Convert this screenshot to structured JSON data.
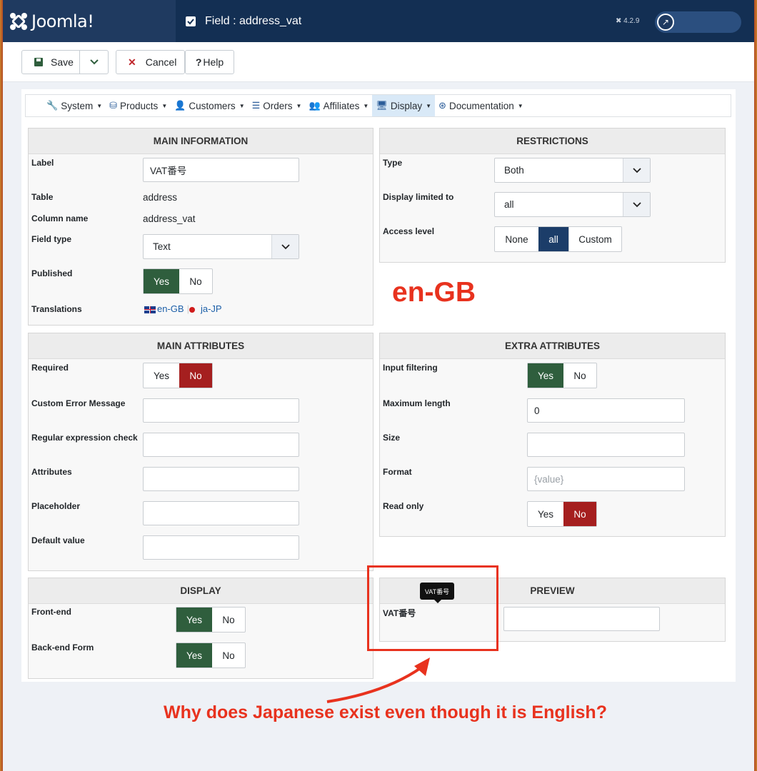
{
  "header": {
    "logo_text": "Joomla!",
    "page_title": "Field : address_vat",
    "version": "4.2.9"
  },
  "toolbar": {
    "save_label": "Save",
    "cancel_label": "Cancel",
    "help_label": "Help"
  },
  "menu": [
    {
      "label": "System",
      "icon": "wrench-icon"
    },
    {
      "label": "Products",
      "icon": "cubes-icon"
    },
    {
      "label": "Customers",
      "icon": "user-icon"
    },
    {
      "label": "Orders",
      "icon": "list-icon"
    },
    {
      "label": "Affiliates",
      "icon": "users-icon"
    },
    {
      "label": "Display",
      "icon": "monitor-icon",
      "active": true
    },
    {
      "label": "Documentation",
      "icon": "lifebuoy-icon"
    }
  ],
  "main_information": {
    "title": "MAIN INFORMATION",
    "label_label": "Label",
    "label_value": "VAT番号",
    "table_label": "Table",
    "table_value": "address",
    "column_label": "Column name",
    "column_value": "address_vat",
    "field_type_label": "Field type",
    "field_type_value": "Text",
    "published_label": "Published",
    "yes": "Yes",
    "no": "No",
    "translations_label": "Translations",
    "trans_en": "en-GB",
    "trans_ja": "ja-JP"
  },
  "restrictions": {
    "title": "RESTRICTIONS",
    "type_label": "Type",
    "type_value": "Both",
    "display_limited_label": "Display limited to",
    "display_limited_value": "all",
    "access_label": "Access level",
    "access_none": "None",
    "access_all": "all",
    "access_custom": "Custom"
  },
  "main_attributes": {
    "title": "MAIN ATTRIBUTES",
    "required_label": "Required",
    "yes": "Yes",
    "no": "No",
    "error_label": "Custom Error Message",
    "regex_label": "Regular expression check",
    "attributes_label": "Attributes",
    "placeholder_label": "Placeholder",
    "default_label": "Default value"
  },
  "extra_attributes": {
    "title": "EXTRA ATTRIBUTES",
    "filter_label": "Input filtering",
    "yes": "Yes",
    "no": "No",
    "maxlen_label": "Maximum length",
    "maxlen_value": "0",
    "size_label": "Size",
    "format_label": "Format",
    "format_placeholder": "{value}",
    "readonly_label": "Read only"
  },
  "display": {
    "title": "DISPLAY",
    "frontend_label": "Front-end",
    "backend_label": "Back-end Form",
    "yes": "Yes",
    "no": "No"
  },
  "preview": {
    "title": "PREVIEW",
    "field_label": "VAT番号",
    "tooltip": "VAT番号"
  },
  "annotations": {
    "locale": "en-GB",
    "question": "Why does Japanese exist even though it is English?"
  }
}
